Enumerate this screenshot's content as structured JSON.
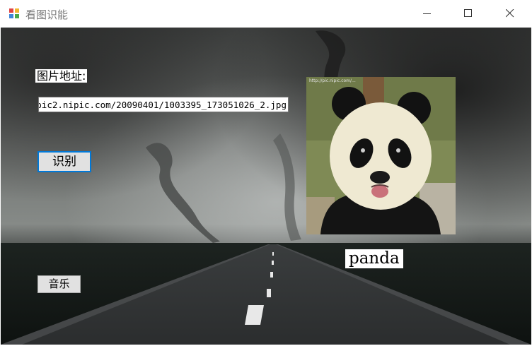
{
  "window": {
    "title": "看图识能",
    "minimize_icon": "minimize-icon",
    "maximize_icon": "maximize-icon",
    "close_icon": "close-icon"
  },
  "form": {
    "address_label": "图片地址:",
    "url_value": "pic2.nipic.com/20090401/1003395_173051026_2.jpg",
    "recognize_label": "识别",
    "music_label": "音乐",
    "result_text": "panda"
  },
  "image": {
    "subject": "panda",
    "watermark": "http://pic.nipic.com/..."
  },
  "colors": {
    "focus_border": "#0078d7",
    "button_face": "#e1e1e1"
  }
}
